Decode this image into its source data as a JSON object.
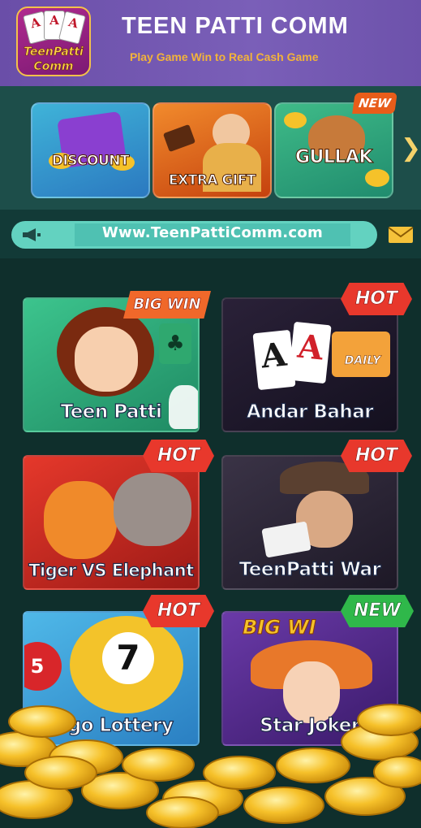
{
  "header": {
    "logo_card1": "A",
    "logo_card2": "A",
    "logo_card3": "A",
    "logo_name_line1": "TeenPatti",
    "logo_name_line2": "Comm",
    "title": "TEEN PATTI COMM",
    "subtitle": "Play Game Win to Real Cash Game"
  },
  "promos": [
    {
      "label": "DISCOUNT"
    },
    {
      "label": "EXTRA GIFT"
    },
    {
      "label": "GULLAK",
      "tag": "NEW"
    }
  ],
  "promo_next_icon": "chevron-right-icon",
  "site_bar": {
    "speaker_icon": "megaphone-icon",
    "url": "Www.TeenPattiComm.com",
    "mail_icon": "envelope-icon"
  },
  "games": [
    {
      "title": "Teen Patti",
      "badge": "BIG WIN",
      "badge_type": "bigwin"
    },
    {
      "title": "Andar Bahar",
      "badge": "HOT",
      "badge_type": "hot",
      "extra": "DAILY"
    },
    {
      "title": "Tiger VS Elephant",
      "badge": "HOT",
      "badge_type": "hot"
    },
    {
      "title": "TeenPatti War",
      "badge": "HOT",
      "badge_type": "hot"
    },
    {
      "title": "ingo Lottery",
      "badge": "HOT",
      "badge_type": "hot"
    },
    {
      "title": "Star Joker",
      "badge": "NEW",
      "badge_type": "new",
      "extra": "BIG WI"
    }
  ],
  "colors": {
    "header_bg": "#6a4ea8",
    "title_text": "#ffffff",
    "subtitle_text": "#f2b33a",
    "site_bar": "#63d2c0",
    "hot_badge": "#e8382c",
    "new_badge": "#2fb84a",
    "page_bg": "#123a37"
  }
}
